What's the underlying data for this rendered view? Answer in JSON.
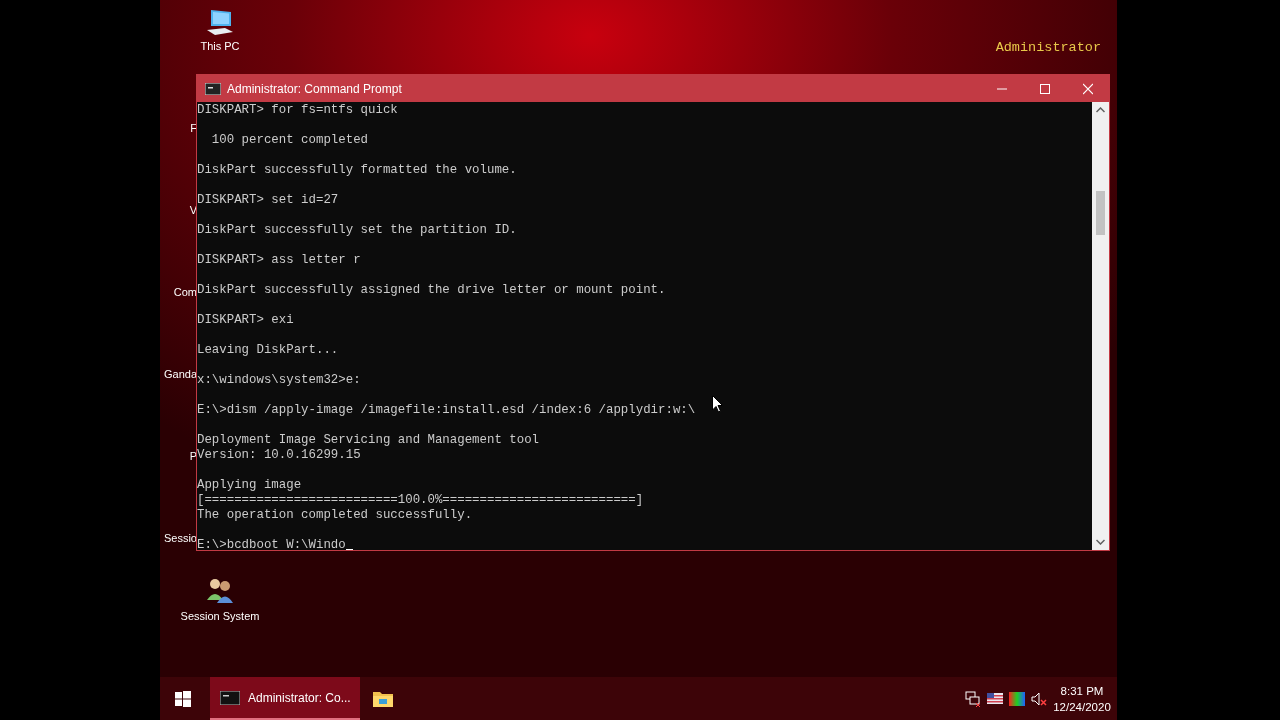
{
  "desktop": {
    "corner_label": "Administrator",
    "icons": [
      {
        "kind": "computer",
        "label": "This PC"
      },
      {
        "kind": "covered",
        "label": "F"
      },
      {
        "kind": "covered",
        "label": "V"
      },
      {
        "kind": "covered",
        "label": "Com"
      },
      {
        "kind": "covered",
        "label": "Ganda"
      },
      {
        "kind": "covered",
        "label": "P"
      },
      {
        "kind": "covered",
        "label": "Sessio"
      },
      {
        "kind": "users",
        "label": "Session System"
      }
    ]
  },
  "window": {
    "title": "Administrator: Command Prompt",
    "console_blocks": [
      [
        "DISKPART> for fs=ntfs quick"
      ],
      [
        "  100 percent completed"
      ],
      [
        "DiskPart successfully formatted the volume."
      ],
      [
        "DISKPART> set id=27"
      ],
      [
        "DiskPart successfully set the partition ID."
      ],
      [
        "DISKPART> ass letter r"
      ],
      [
        "DiskPart successfully assigned the drive letter or mount point."
      ],
      [
        "DISKPART> exi"
      ],
      [
        "Leaving DiskPart..."
      ],
      [
        "x:\\windows\\system32>e:"
      ],
      [
        "E:\\>dism /apply-image /imagefile:install.esd /index:6 /applydir:w:\\"
      ],
      [
        "Deployment Image Servicing and Management tool",
        "Version: 10.0.16299.15"
      ],
      [
        "Applying image",
        "[==========================100.0%==========================]",
        "The operation completed successfully."
      ],
      [
        "E:\\>bcdboot W:\\Windo"
      ]
    ]
  },
  "taskbar": {
    "buttons": [
      {
        "kind": "start",
        "selected": false
      },
      {
        "kind": "console",
        "label": "Administrator: Co...",
        "selected": true
      },
      {
        "kind": "folder",
        "selected": false
      }
    ],
    "clock": {
      "time": "8:31 PM",
      "date": "12/24/2020"
    }
  }
}
